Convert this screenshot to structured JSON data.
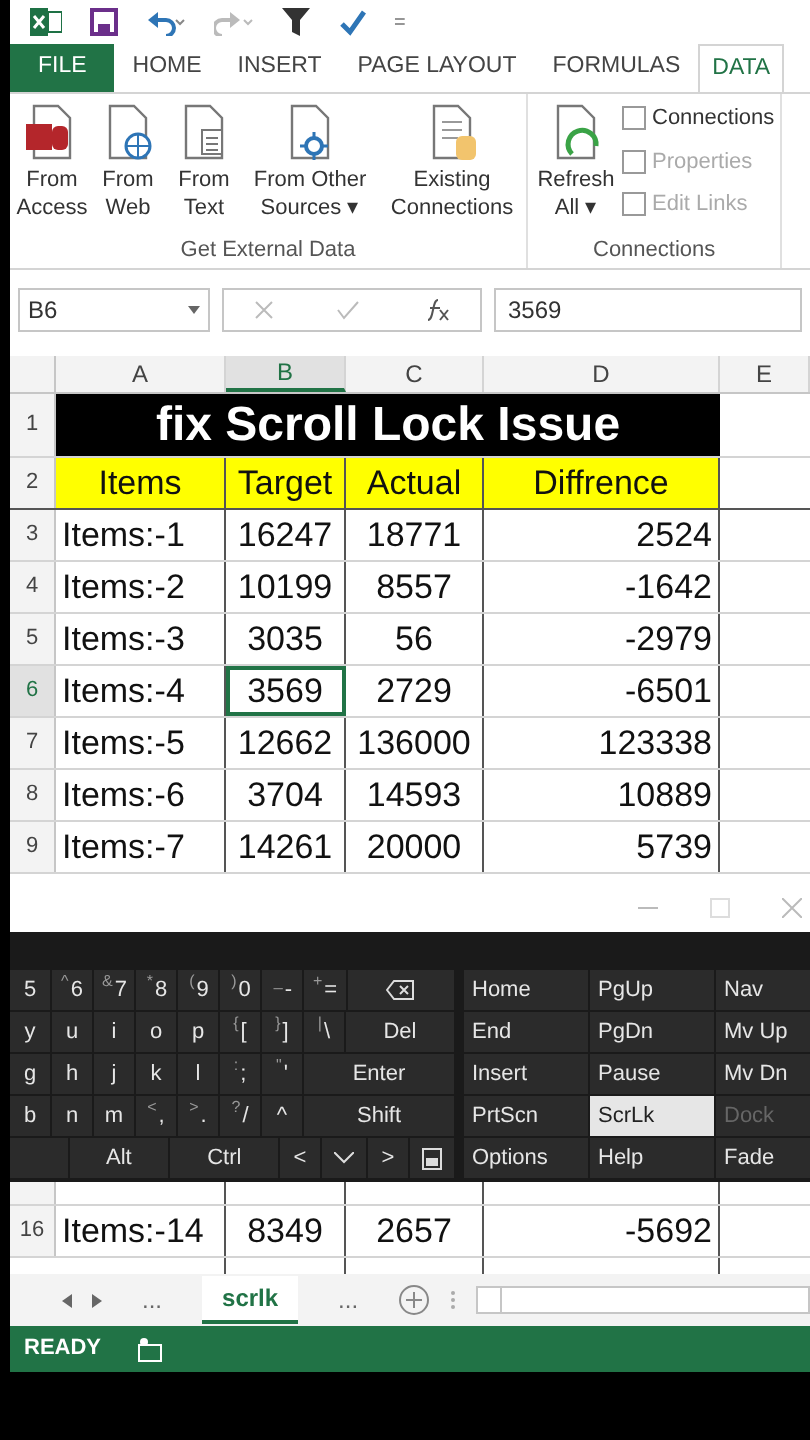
{
  "quick_access": {
    "customize": "="
  },
  "ribbon_tabs": [
    {
      "label": "FILE",
      "kind": "file",
      "selected": false
    },
    {
      "label": "HOME",
      "kind": "tab",
      "selected": false
    },
    {
      "label": "INSERT",
      "kind": "tab",
      "selected": false
    },
    {
      "label": "PAGE LAYOUT",
      "kind": "tab",
      "selected": false
    },
    {
      "label": "FORMULAS",
      "kind": "tab",
      "selected": false
    },
    {
      "label": "DATA",
      "kind": "tab",
      "selected": true
    }
  ],
  "ribbon_groups": [
    {
      "title": "Get External Data",
      "buttons": [
        {
          "label": "From Access",
          "kind": "access"
        },
        {
          "label": "From Web",
          "kind": "web"
        },
        {
          "label": "From Text",
          "kind": "text"
        },
        {
          "label": "From Other Sources ▾",
          "kind": "other"
        },
        {
          "label": "Existing Connections",
          "kind": "existing"
        }
      ]
    },
    {
      "title": "Connections",
      "buttons": [
        {
          "label": "Refresh All ▾",
          "kind": "refresh"
        }
      ],
      "small": [
        {
          "label": "Connections",
          "disabled": false
        },
        {
          "label": "Properties",
          "disabled": true
        },
        {
          "label": "Edit Links",
          "disabled": true
        }
      ]
    }
  ],
  "formula_bar": {
    "name_box": "B6",
    "value": "3569"
  },
  "columns": [
    {
      "label": "A",
      "selected": false
    },
    {
      "label": "B",
      "selected": true
    },
    {
      "label": "C",
      "selected": false
    },
    {
      "label": "D",
      "selected": false
    },
    {
      "label": "E",
      "selected": false
    }
  ],
  "sheet": {
    "title_row": {
      "number": "1",
      "text": "fix Scroll Lock Issue"
    },
    "header_row": {
      "number": "2",
      "cells": [
        "Items",
        "Target",
        "Actual",
        "Diffrence"
      ]
    },
    "rows": [
      {
        "number": "3",
        "selected": false,
        "cells": [
          "Items:-1",
          "16247",
          "18771",
          "2524"
        ]
      },
      {
        "number": "4",
        "selected": false,
        "cells": [
          "Items:-2",
          "10199",
          "8557",
          "-1642"
        ]
      },
      {
        "number": "5",
        "selected": false,
        "cells": [
          "Items:-3",
          "3035",
          "56",
          "-2979"
        ]
      },
      {
        "number": "6",
        "selected": true,
        "cells": [
          "Items:-4",
          "3569",
          "2729",
          "-6501"
        ]
      },
      {
        "number": "7",
        "selected": false,
        "cells": [
          "Items:-5",
          "12662",
          "136000",
          "123338"
        ]
      },
      {
        "number": "8",
        "selected": false,
        "cells": [
          "Items:-6",
          "3704",
          "14593",
          "10889"
        ]
      },
      {
        "number": "9",
        "selected": false,
        "cells": [
          "Items:-7",
          "14261",
          "20000",
          "5739"
        ]
      }
    ],
    "bottom_rows": [
      {
        "number": "16",
        "selected": false,
        "cells": [
          "Items:-14",
          "8349",
          "2657",
          "-5692"
        ]
      }
    ]
  },
  "keyboard": {
    "keys": [
      [
        {
          "kind": "key",
          "label": "5"
        },
        {
          "kind": "key",
          "shift": "^",
          "label": "6"
        },
        {
          "kind": "key",
          "shift": "&",
          "label": "7"
        },
        {
          "kind": "key",
          "shift": "*",
          "label": "8"
        },
        {
          "kind": "key",
          "shift": "(",
          "label": "9"
        },
        {
          "kind": "key",
          "shift": ")",
          "label": "0"
        },
        {
          "kind": "key",
          "shift": "_",
          "label": "-"
        },
        {
          "kind": "key",
          "shift": "+",
          "label": "="
        },
        {
          "kind": "backspace"
        }
      ],
      [
        {
          "kind": "key",
          "label": "y"
        },
        {
          "kind": "key",
          "label": "u"
        },
        {
          "kind": "key",
          "label": "i"
        },
        {
          "kind": "key",
          "label": "o"
        },
        {
          "kind": "key",
          "label": "p"
        },
        {
          "kind": "key",
          "shift": "{",
          "label": "["
        },
        {
          "kind": "key",
          "shift": "}",
          "label": "]"
        },
        {
          "kind": "key",
          "shift": "|",
          "label": "\\"
        },
        {
          "kind": "key",
          "label": "Del"
        }
      ],
      [
        {
          "kind": "key",
          "label": "g"
        },
        {
          "kind": "key",
          "label": "h"
        },
        {
          "kind": "key",
          "label": "j"
        },
        {
          "kind": "key",
          "label": "k"
        },
        {
          "kind": "key",
          "label": "l"
        },
        {
          "kind": "key",
          "shift": ":",
          "label": ";"
        },
        {
          "kind": "key",
          "shift": "\"",
          "label": "'"
        },
        {
          "kind": "key",
          "label": "Enter"
        }
      ],
      [
        {
          "kind": "key",
          "label": "b"
        },
        {
          "kind": "key",
          "label": "n"
        },
        {
          "kind": "key",
          "label": "m"
        },
        {
          "kind": "key",
          "shift": "<",
          "label": ","
        },
        {
          "kind": "key",
          "shift": ">",
          "label": "."
        },
        {
          "kind": "key",
          "shift": "?",
          "label": "/"
        },
        {
          "kind": "key",
          "label": "^"
        },
        {
          "kind": "key",
          "label": "Shift"
        }
      ],
      [
        {
          "kind": "spacer"
        },
        {
          "kind": "key",
          "label": "Alt"
        },
        {
          "kind": "key",
          "label": "Ctrl"
        },
        {
          "kind": "key",
          "label": "<"
        },
        {
          "kind": "down"
        },
        {
          "kind": "key",
          "label": ">"
        },
        {
          "kind": "menu"
        }
      ]
    ],
    "nav_keys": [
      [
        {
          "label": "Home",
          "selected": false,
          "disabled": false
        },
        {
          "label": "PgUp",
          "selected": false,
          "disabled": false
        },
        {
          "label": "Nav",
          "selected": false,
          "disabled": false
        }
      ],
      [
        {
          "label": "End",
          "selected": false,
          "disabled": false
        },
        {
          "label": "PgDn",
          "selected": false,
          "disabled": false
        },
        {
          "label": "Mv Up",
          "selected": false,
          "disabled": false
        }
      ],
      [
        {
          "label": "Insert",
          "selected": false,
          "disabled": false
        },
        {
          "label": "Pause",
          "selected": false,
          "disabled": false
        },
        {
          "label": "Mv Dn",
          "selected": false,
          "disabled": false
        }
      ],
      [
        {
          "label": "PrtScn",
          "selected": false,
          "disabled": false
        },
        {
          "label": "ScrLk",
          "selected": true,
          "disabled": false
        },
        {
          "label": "Dock",
          "selected": false,
          "disabled": true
        }
      ],
      [
        {
          "label": "Options",
          "selected": false,
          "disabled": false
        },
        {
          "label": "Help",
          "selected": false,
          "disabled": false
        },
        {
          "label": "Fade",
          "selected": false,
          "disabled": false
        }
      ]
    ]
  },
  "sheet_tabs": [
    {
      "label": "...",
      "selected": false
    },
    {
      "label": "scrlk",
      "selected": true
    },
    {
      "label": "...",
      "selected": false
    }
  ],
  "status_bar": {
    "text": "READY"
  }
}
